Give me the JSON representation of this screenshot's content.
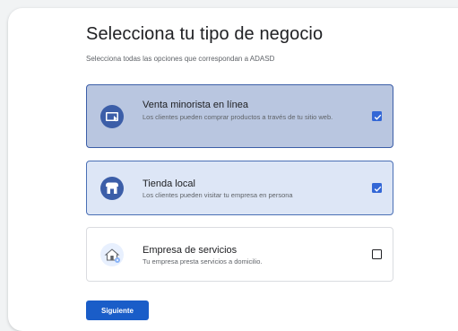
{
  "header": {
    "title": "Selecciona tu tipo de negocio",
    "subtitle": "Selecciona todas las opciones que correspondan a ADASD"
  },
  "options": [
    {
      "title": "Venta minorista en línea",
      "description": "Los clientes pueden comprar productos a través de tu sitio web.",
      "icon": "online-store-icon",
      "checked": true
    },
    {
      "title": "Tienda local",
      "description": "Los clientes pueden visitar tu empresa en persona",
      "icon": "storefront-icon",
      "checked": true
    },
    {
      "title": "Empresa de servicios",
      "description": "Tu empresa presta servicios a domicilio.",
      "icon": "home-service-icon",
      "checked": false
    }
  ],
  "actions": {
    "next_label": "Siguiente"
  },
  "colors": {
    "accent": "#1a5dc8",
    "selected_fill_1": "#b9c6e0",
    "selected_fill_2": "#dde6f6",
    "checkbox_checked": "#3367d6"
  }
}
